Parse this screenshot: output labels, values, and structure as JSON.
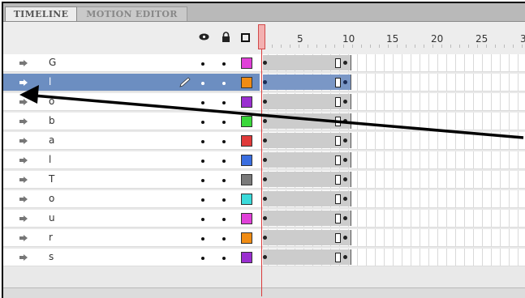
{
  "tabs": [
    {
      "label": "TIMELINE"
    },
    {
      "label": "MOTION EDITOR"
    }
  ],
  "header_icons": [
    "eye-icon",
    "lock-icon",
    "outline-icon"
  ],
  "ruler": {
    "labels": [
      "5",
      "10",
      "15",
      "20",
      "25",
      "3"
    ]
  },
  "layers": [
    {
      "name": "G",
      "color": "#e040d8"
    },
    {
      "name": "l",
      "color": "#f08c14",
      "selected": true
    },
    {
      "name": "o",
      "color": "#9a2fd0"
    },
    {
      "name": "b",
      "color": "#3ad83a"
    },
    {
      "name": "a",
      "color": "#e03a3a"
    },
    {
      "name": "l",
      "color": "#3a6ee0"
    },
    {
      "name": "T",
      "color": "#7a7a7a"
    },
    {
      "name": "o",
      "color": "#3adada"
    },
    {
      "name": "u",
      "color": "#e040d8"
    },
    {
      "name": "r",
      "color": "#f08c14"
    },
    {
      "name": "s",
      "color": "#9a2fd0"
    }
  ],
  "colors": {
    "selection": "#6c8ec1",
    "playhead": "#d93a3a"
  }
}
